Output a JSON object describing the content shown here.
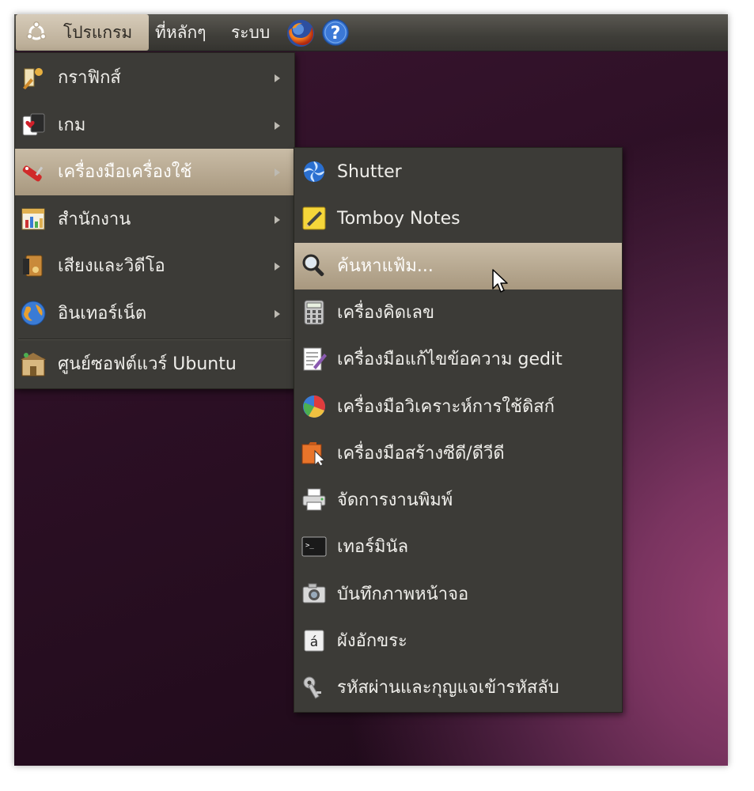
{
  "panel": {
    "applications_label": "โปรแกรม",
    "places_label": "ที่หลักๆ",
    "system_label": "ระบบ",
    "icons": [
      "ubuntu-logo-icon",
      "firefox-icon",
      "help-icon"
    ]
  },
  "main_menu": {
    "items": [
      {
        "label": "กราฟิกส์",
        "icon": "graphics-icon"
      },
      {
        "label": "เกม",
        "icon": "games-icon"
      },
      {
        "label": "เครื่องมือเครื่องใช้",
        "icon": "accessories-icon"
      },
      {
        "label": "สำนักงาน",
        "icon": "office-icon"
      },
      {
        "label": "เสียงและวิดีโอ",
        "icon": "sound-video-icon"
      },
      {
        "label": "อินเทอร์เน็ต",
        "icon": "internet-icon"
      },
      {
        "label": "ศูนย์ซอฟต์แวร์ Ubuntu",
        "icon": "software-center-icon"
      }
    ],
    "active_index": 2
  },
  "submenu": {
    "items": [
      {
        "label": "Shutter",
        "icon": "shutter-icon"
      },
      {
        "label": "Tomboy Notes",
        "icon": "tomboy-notes-icon"
      },
      {
        "label": "ค้นหาแฟ้ม...",
        "icon": "search-icon"
      },
      {
        "label": "เครื่องคิดเลข",
        "icon": "calculator-icon"
      },
      {
        "label": "เครื่องมือแก้ไขข้อความ gedit",
        "icon": "text-editor-icon"
      },
      {
        "label": "เครื่องมือวิเคราะห์การใช้ดิสก์",
        "icon": "disk-usage-icon"
      },
      {
        "label": "เครื่องมือสร้างซีดี/ดีวีดี",
        "icon": "cd-burner-icon"
      },
      {
        "label": "จัดการงานพิมพ์",
        "icon": "printer-icon"
      },
      {
        "label": "เทอร์มินัล",
        "icon": "terminal-icon"
      },
      {
        "label": "บันทึกภาพหน้าจอ",
        "icon": "screenshot-icon"
      },
      {
        "label": "ผังอักขระ",
        "icon": "character-map-icon"
      },
      {
        "label": "รหัสผ่านและกุญแจเข้ารหัสลับ",
        "icon": "passwords-keys-icon"
      }
    ],
    "active_index": 2
  },
  "colors": {
    "panel": "#3f3e39",
    "menu_background": "#3c3b37",
    "highlight": "#b8aa93",
    "desktop": "#4f2142"
  }
}
